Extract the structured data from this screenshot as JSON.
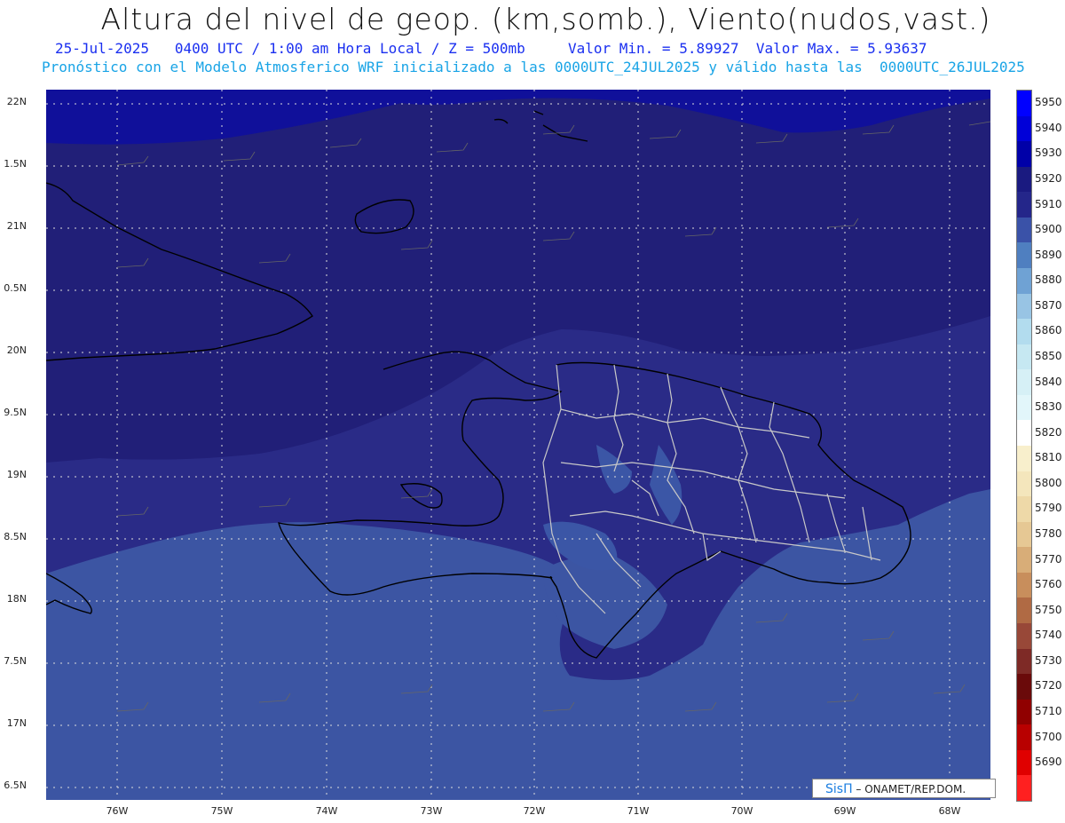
{
  "title": "Altura del nivel de geop. (km,somb.), Viento(nudos,vast.)",
  "subtitle_line1": "25-Jul-2025   0400 UTC / 1:00 am Hora Local / Z = 500mb     Valor Min. = 5.89927  Valor Max. = 5.93637",
  "subtitle_line2": "Pronóstico con el Modelo Atmosferico WRF inicializado a las 0000UTC_24JUL2025 y válido hasta las  0000UTC_26JUL2025",
  "lat_labels": [
    "22N",
    "1.5N",
    "21N",
    "0.5N",
    "20N",
    "9.5N",
    "19N",
    "8.5N",
    "18N",
    "7.5N",
    "17N",
    "6.5N"
  ],
  "lon_labels": [
    "76W",
    "75W",
    "74W",
    "73W",
    "72W",
    "71W",
    "70W",
    "69W",
    "68W"
  ],
  "colorbar": {
    "labels": [
      "5950",
      "5940",
      "5930",
      "5920",
      "5910",
      "5900",
      "5890",
      "5880",
      "5870",
      "5860",
      "5850",
      "5840",
      "5830",
      "5820",
      "5810",
      "5800",
      "5790",
      "5780",
      "5770",
      "5760",
      "5750",
      "5740",
      "5730",
      "5720",
      "5710",
      "5700",
      "5690"
    ],
    "colors": [
      "#0000ff",
      "#0000d8",
      "#0000a8",
      "#1a1a80",
      "#24268a",
      "#3a52a8",
      "#4f7fc0",
      "#6fa2d4",
      "#98c4e4",
      "#b2dcee",
      "#c6e8f2",
      "#d6f0f6",
      "#e2f6fa",
      "#ffffff",
      "#f8efcc",
      "#f4e6bc",
      "#eed9a8",
      "#e6c894",
      "#d8ad78",
      "#c88e5c",
      "#b06a44",
      "#984838",
      "#7e2a26",
      "#6a0a0a",
      "#900000",
      "#b80000",
      "#e00000",
      "#ff2020"
    ]
  },
  "credit": {
    "logo": "SisΠ",
    "text": " – ONAMET/REP.DOM."
  },
  "colors": {
    "deep_field": "#211f78",
    "mid_field": "#2a2c86",
    "south_field": "#3c55a3",
    "north_band": "#1a1877",
    "top_band": "#0f0e8c",
    "coast": "#000000",
    "borders": "#c8c8c8"
  }
}
